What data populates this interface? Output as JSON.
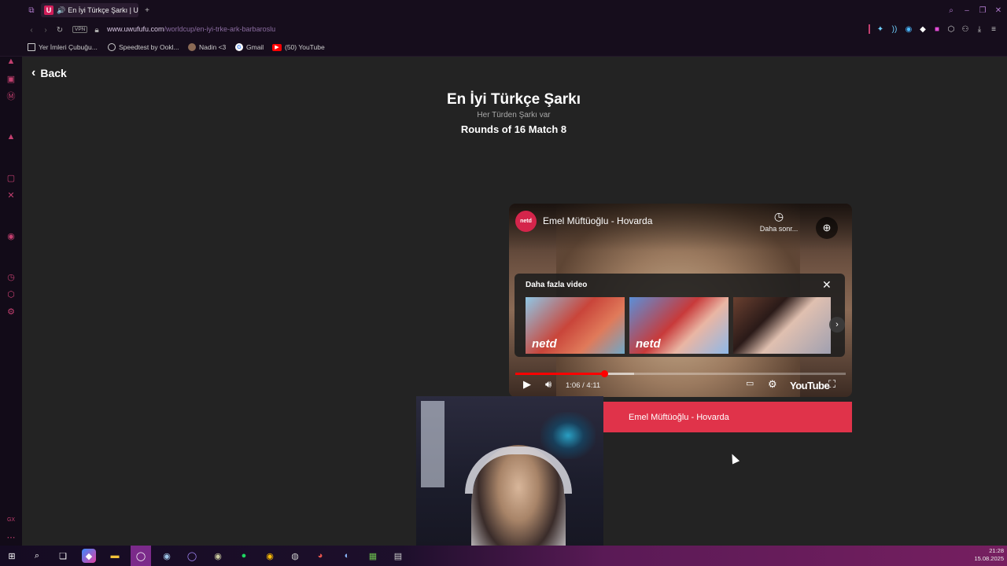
{
  "tab": {
    "favicon": "U",
    "title": "En İyi Türkçe Şarkı | U"
  },
  "address": {
    "vpn": "VPN",
    "host": "www.uwufufu.com",
    "path": "/worldcup/en-iyi-trke-ark-barbaroslu"
  },
  "bookmarks": [
    {
      "label": "Yer İmleri Çubuğu...",
      "icon": "folder-icon"
    },
    {
      "label": "Speedtest by Ookl...",
      "icon": "speedtest-icon"
    },
    {
      "label": "Nadin <3",
      "icon": "avatar-icon"
    },
    {
      "label": "Gmail",
      "icon": "google-icon"
    },
    {
      "label": "(50) YouTube",
      "icon": "youtube-icon"
    }
  ],
  "page": {
    "back_label": "Back",
    "title": "En İyi Türkçe Şarkı",
    "subtitle": "Her Türden Şarkı var",
    "round": "Rounds of 16 Match 8"
  },
  "video": {
    "channel": "netd",
    "title": "Emel Müftüoğlu - Hovarda",
    "watch_later": "Daha sonr...",
    "more_videos_label": "Daha fazla video",
    "thumb_logo": "netd",
    "time": "1:06 / 4:11",
    "progress": 0.27,
    "buffered": 0.36,
    "youtube_label": "YouTube"
  },
  "choice_button": "Emel Müftüoğlu - Hovarda",
  "clock": {
    "time": "21:28",
    "date": "15.08.2025"
  },
  "colors": {
    "accent": "#e0334a",
    "browser_accent": "#c23f6f",
    "youtube_red": "#ff0000"
  }
}
